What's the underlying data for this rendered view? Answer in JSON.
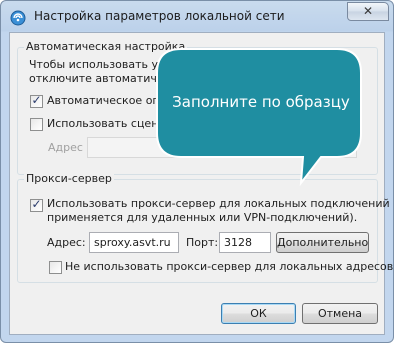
{
  "window": {
    "title": "Настройка параметров локальной сети",
    "close_glyph": "✕"
  },
  "auto_config": {
    "legend": "Автоматическая настройка",
    "description_line1": "Чтобы использовать устан",
    "description_line2": "отключите автоматическ",
    "auto_detect_label": "Автоматическое опред",
    "auto_detect_checked": true,
    "use_script_label": "Использовать сценари",
    "use_script_checked": false,
    "address_label": "Адрес",
    "address_value": ""
  },
  "proxy": {
    "legend": "Прокси-сервер",
    "use_proxy_line1": "Использовать прокси-сервер для локальных подключений (не",
    "use_proxy_line2": "применяется для удаленных или VPN-подключений).",
    "use_proxy_checked": true,
    "address_label": "Адрес:",
    "address_value": "sproxy.asvt.ru",
    "port_label": "Порт:",
    "port_value": "3128",
    "advanced_button": "Дополнительно",
    "bypass_label": "Не использовать прокси-сервер для локальных адресов",
    "bypass_checked": false
  },
  "buttons": {
    "ok": "ОК",
    "cancel": "Отмена"
  },
  "callout": {
    "text": "Заполните по образцу",
    "fill_color": "#1f8ea1",
    "stroke_color": "#ffffff"
  },
  "icons": {
    "app_icon": "network-settings-icon",
    "check_glyph": "✓"
  }
}
